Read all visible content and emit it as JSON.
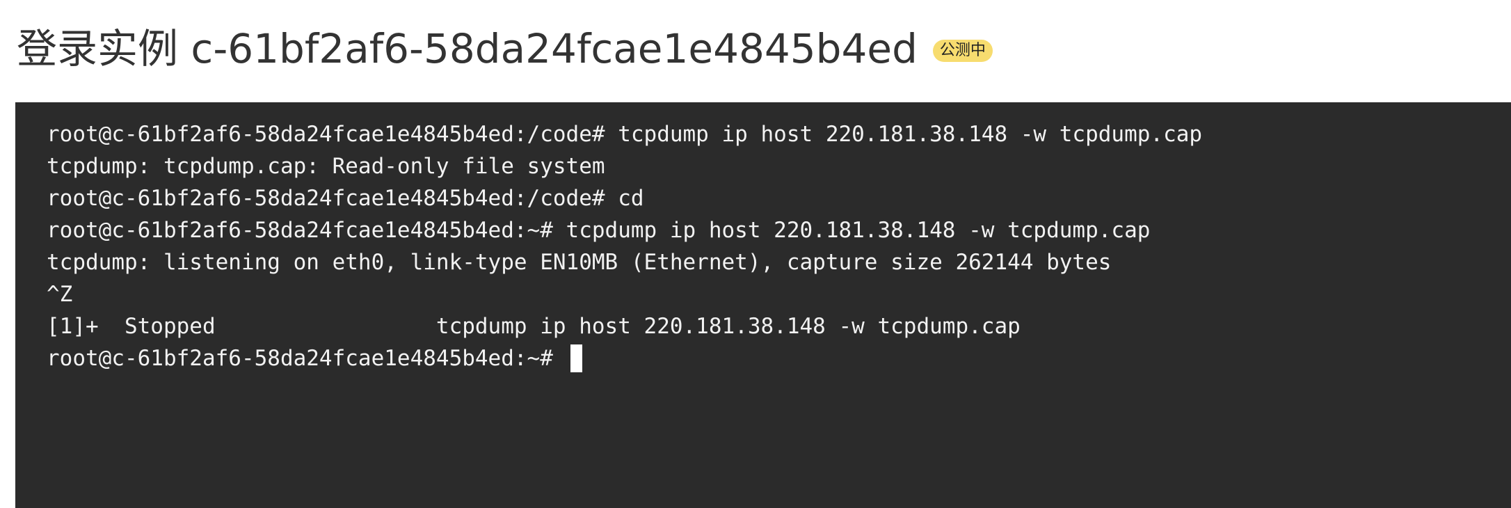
{
  "header": {
    "title": "登录实例 c-61bf2af6-58da24fcae1e4845b4ed",
    "badge": "公测中"
  },
  "terminal": {
    "lines": [
      "root@c-61bf2af6-58da24fcae1e4845b4ed:/code# tcpdump ip host 220.181.38.148 -w tcpdump.cap",
      "tcpdump: tcpdump.cap: Read-only file system",
      "root@c-61bf2af6-58da24fcae1e4845b4ed:/code# cd",
      "root@c-61bf2af6-58da24fcae1e4845b4ed:~# tcpdump ip host 220.181.38.148 -w tcpdump.cap",
      "tcpdump: listening on eth0, link-type EN10MB (Ethernet), capture size 262144 bytes",
      "^Z",
      "[1]+  Stopped                 tcpdump ip host 220.181.38.148 -w tcpdump.cap",
      "root@c-61bf2af6-58da24fcae1e4845b4ed:~# "
    ]
  },
  "colors": {
    "terminal_bg": "#2b2b2b",
    "terminal_text": "#f2f2f2",
    "badge_bg": "#f7dc6f",
    "title_text": "#333333",
    "cursor": "#ffffff"
  }
}
